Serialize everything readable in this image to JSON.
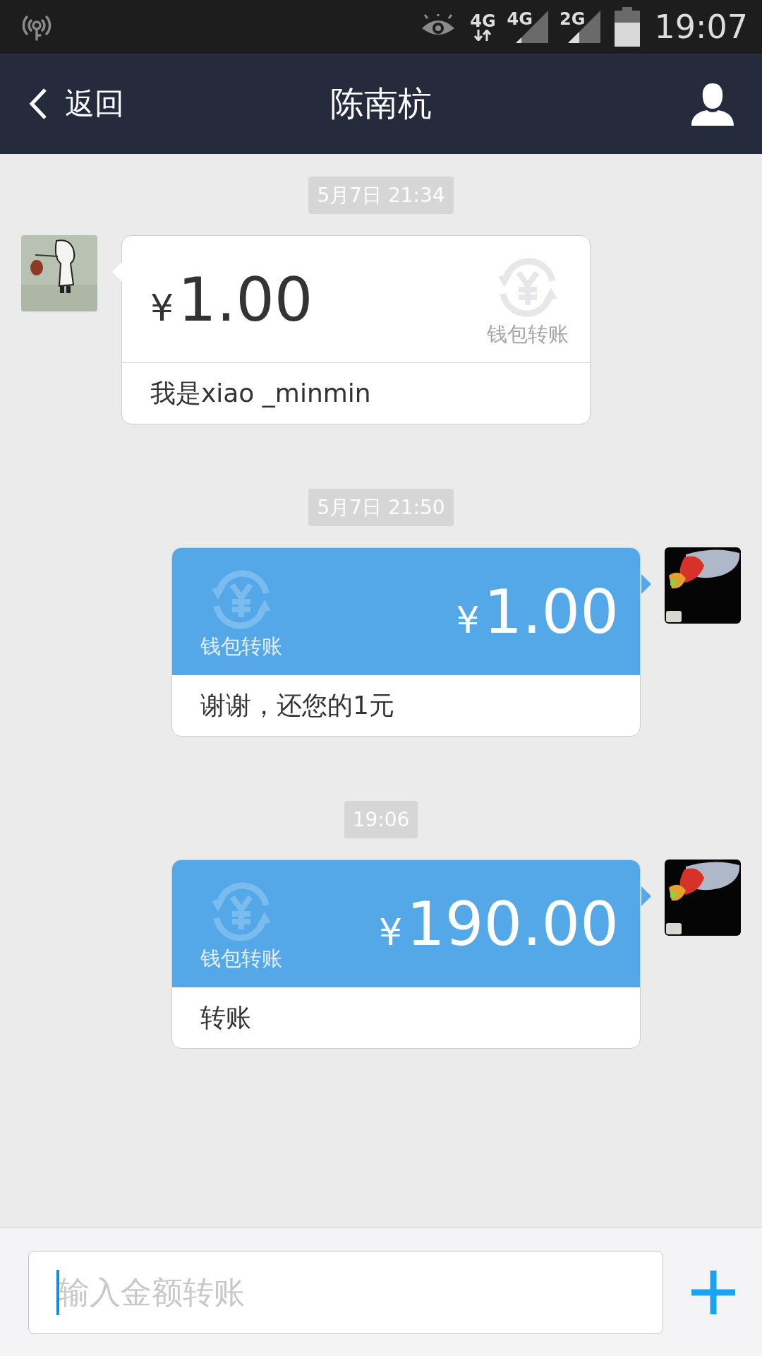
{
  "status_bar": {
    "network_1": "4G",
    "network_2": "4G",
    "network_3": "2G",
    "time": "19:07"
  },
  "nav": {
    "back": "返回",
    "title": "陈南杭"
  },
  "messages": [
    {
      "timestamp": "5月7日 21:34",
      "kind": "received",
      "currency": "¥",
      "amount": "1.00",
      "badge": "钱包转账",
      "note": "我是xiao _minmin"
    },
    {
      "timestamp": "5月7日 21:50",
      "kind": "sent",
      "currency": "¥",
      "amount": "1.00",
      "badge": "钱包转账",
      "note": "谢谢，还您的1元"
    },
    {
      "timestamp": "19:06",
      "kind": "sent",
      "currency": "¥",
      "amount": "190.00",
      "badge": "钱包转账",
      "note": "转账"
    }
  ],
  "composer": {
    "placeholder": "输入金额转账"
  }
}
